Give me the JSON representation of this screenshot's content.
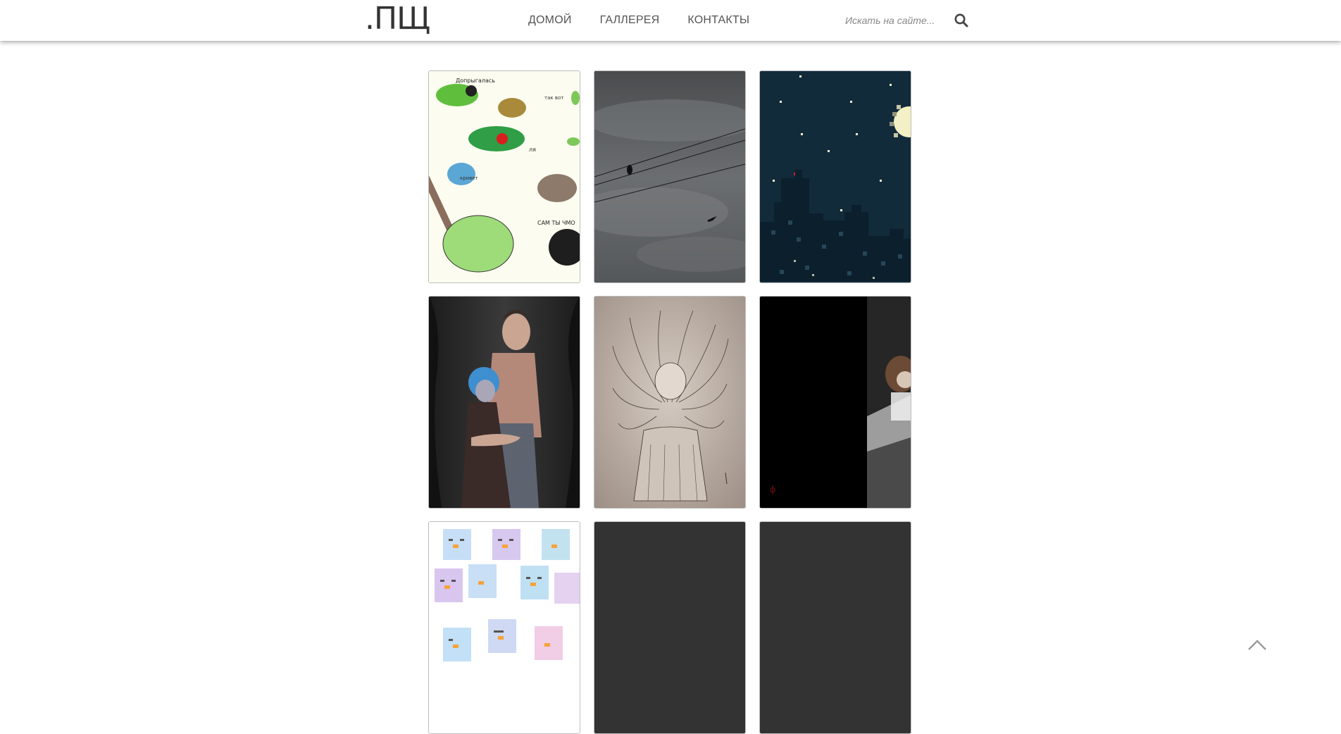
{
  "header": {
    "logo": ".ПЩ",
    "nav": [
      {
        "label": "ДОМОЙ"
      },
      {
        "label": "ГАЛЛЕРЕЯ"
      },
      {
        "label": "КОНТАКТЫ"
      }
    ],
    "search": {
      "placeholder": "Искать на сайте...",
      "value": ""
    }
  },
  "gallery": {
    "items": [
      {
        "subject": "frogs-sketch",
        "texts": [
          "Допрыгалась",
          "так вот",
          "ля",
          "кривет",
          "САМ ТЫ ЧМО"
        ]
      },
      {
        "subject": "birds-on-wires"
      },
      {
        "subject": "pixel-night-city"
      },
      {
        "subject": "hugging-figures"
      },
      {
        "subject": "girl-ink-drawing"
      },
      {
        "subject": "dark-figure"
      },
      {
        "subject": "pixel-penguins"
      },
      {
        "subject": "empty"
      },
      {
        "subject": "empty"
      }
    ]
  },
  "colors": {
    "header_bg": "#ffffff",
    "nav_text": "#555555",
    "logo": "#333333",
    "placeholder_tile": "#333333"
  },
  "icons": {
    "search": "search-icon",
    "scroll_top": "chevron-up-icon"
  }
}
